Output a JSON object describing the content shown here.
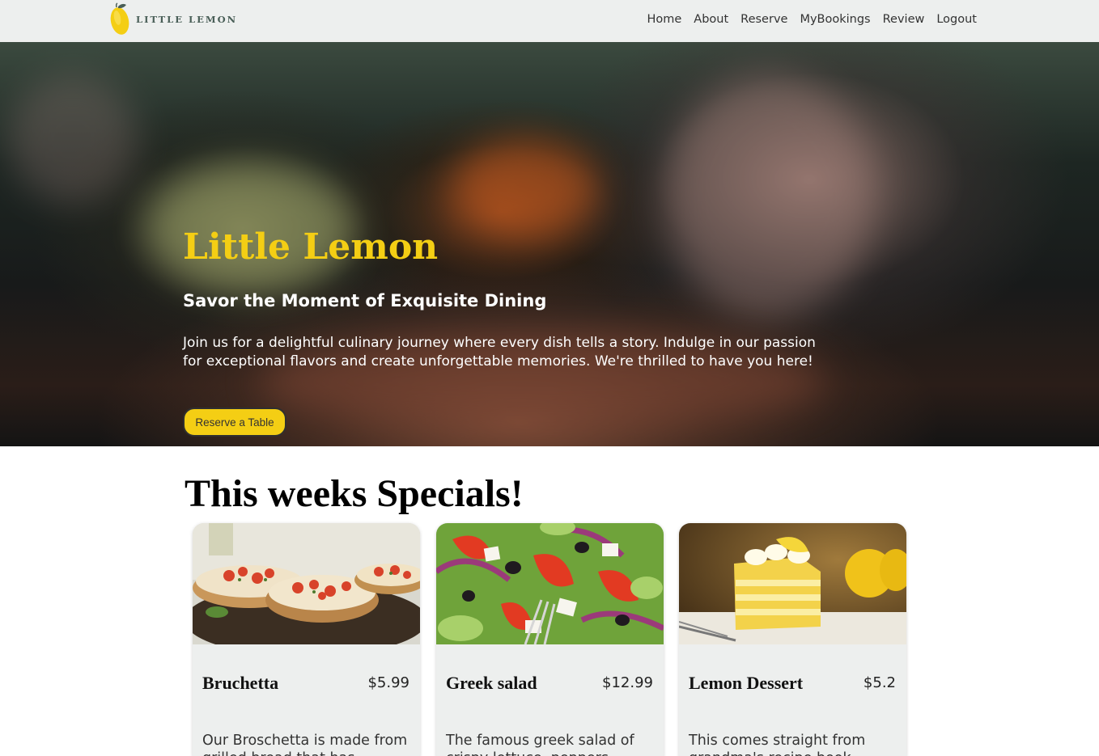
{
  "nav": {
    "logo_text": "LITTLE LEMON",
    "links": [
      {
        "label": "Home"
      },
      {
        "label": "About"
      },
      {
        "label": "Reserve"
      },
      {
        "label": "MyBookings"
      },
      {
        "label": "Review"
      },
      {
        "label": "Logout"
      }
    ]
  },
  "hero": {
    "title": "Little Lemon",
    "subtitle": "Savor the Moment of Exquisite Dining",
    "description": "Join us for a delightful culinary journey where every dish tells a story. Indulge in our passion for exceptional flavors and create unforgettable memories. We're thrilled to have you here!",
    "button_label": "Reserve a Table"
  },
  "specials": {
    "title": "This weeks Specials!",
    "items": [
      {
        "name": "Bruchetta",
        "price": "$5.99",
        "description": "Our Broschetta is made from grilled bread that has"
      },
      {
        "name": "Greek salad",
        "price": "$12.99",
        "description": "The famous greek salad of crispy lettuce, peppers"
      },
      {
        "name": "Lemon Dessert",
        "price": "$5.2",
        "description": "This comes straight from grandma's recipe book"
      }
    ]
  },
  "colors": {
    "primary_green": "#495e57",
    "primary_yellow": "#f4ce14",
    "highlight_light": "#edefee"
  }
}
